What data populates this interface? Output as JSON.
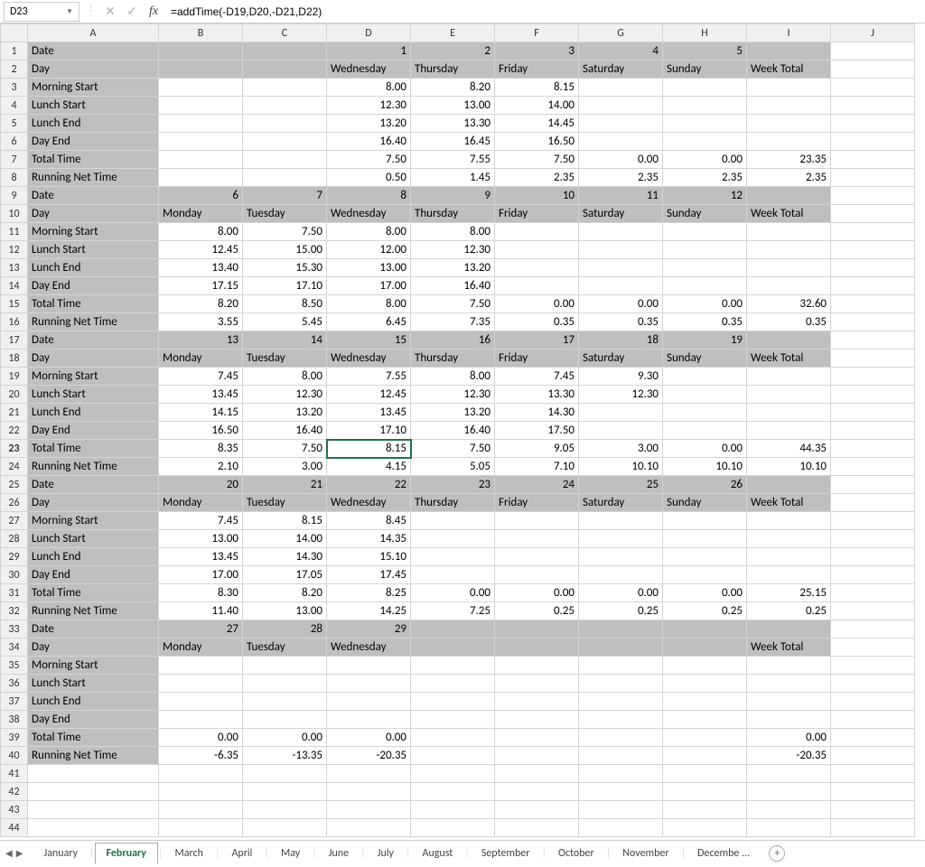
{
  "nameBox": "D23",
  "formula": "=addTime(-D19,D20,-D21,D22)",
  "activeCell": {
    "row": 23,
    "col": 4
  },
  "boldRowHeader": 23,
  "columns": [
    "A",
    "B",
    "C",
    "D",
    "E",
    "F",
    "G",
    "H",
    "I",
    "J"
  ],
  "rowCount": 44,
  "shadedRows": [
    1,
    2,
    9,
    10,
    17,
    18,
    25,
    26,
    33,
    34
  ],
  "colAShadedAll": true,
  "cells": {
    "1": {
      "A": {
        "v": "Date",
        "a": "txt"
      },
      "D": {
        "v": "1",
        "a": "num"
      },
      "E": {
        "v": "2",
        "a": "num"
      },
      "F": {
        "v": "3",
        "a": "num"
      },
      "G": {
        "v": "4",
        "a": "num"
      },
      "H": {
        "v": "5",
        "a": "num"
      }
    },
    "2": {
      "A": {
        "v": "Day",
        "a": "txt"
      },
      "D": {
        "v": "Wednesday",
        "a": "txt"
      },
      "E": {
        "v": "Thursday",
        "a": "txt"
      },
      "F": {
        "v": "Friday",
        "a": "txt"
      },
      "G": {
        "v": "Saturday",
        "a": "txt"
      },
      "H": {
        "v": "Sunday",
        "a": "txt"
      },
      "I": {
        "v": "Week Total",
        "a": "txt"
      }
    },
    "3": {
      "A": {
        "v": "Morning Start",
        "a": "txt"
      },
      "D": {
        "v": "8.00",
        "a": "num"
      },
      "E": {
        "v": "8.20",
        "a": "num"
      },
      "F": {
        "v": "8.15",
        "a": "num"
      }
    },
    "4": {
      "A": {
        "v": "Lunch Start",
        "a": "txt"
      },
      "D": {
        "v": "12.30",
        "a": "num"
      },
      "E": {
        "v": "13.00",
        "a": "num"
      },
      "F": {
        "v": "14.00",
        "a": "num"
      }
    },
    "5": {
      "A": {
        "v": "Lunch End",
        "a": "txt"
      },
      "D": {
        "v": "13.20",
        "a": "num"
      },
      "E": {
        "v": "13.30",
        "a": "num"
      },
      "F": {
        "v": "14.45",
        "a": "num"
      }
    },
    "6": {
      "A": {
        "v": "Day End",
        "a": "txt"
      },
      "D": {
        "v": "16.40",
        "a": "num"
      },
      "E": {
        "v": "16.45",
        "a": "num"
      },
      "F": {
        "v": "16.50",
        "a": "num"
      }
    },
    "7": {
      "A": {
        "v": "Total Time",
        "a": "txt"
      },
      "D": {
        "v": "7.50",
        "a": "num"
      },
      "E": {
        "v": "7.55",
        "a": "num"
      },
      "F": {
        "v": "7.50",
        "a": "num"
      },
      "G": {
        "v": "0.00",
        "a": "num"
      },
      "H": {
        "v": "0.00",
        "a": "num"
      },
      "I": {
        "v": "23.35",
        "a": "num"
      }
    },
    "8": {
      "A": {
        "v": "Running Net Time",
        "a": "txt"
      },
      "D": {
        "v": "0.50",
        "a": "num"
      },
      "E": {
        "v": "1.45",
        "a": "num"
      },
      "F": {
        "v": "2.35",
        "a": "num"
      },
      "G": {
        "v": "2.35",
        "a": "num"
      },
      "H": {
        "v": "2.35",
        "a": "num"
      },
      "I": {
        "v": "2.35",
        "a": "num"
      }
    },
    "9": {
      "A": {
        "v": "Date",
        "a": "txt"
      },
      "B": {
        "v": "6",
        "a": "num"
      },
      "C": {
        "v": "7",
        "a": "num"
      },
      "D": {
        "v": "8",
        "a": "num"
      },
      "E": {
        "v": "9",
        "a": "num"
      },
      "F": {
        "v": "10",
        "a": "num"
      },
      "G": {
        "v": "11",
        "a": "num"
      },
      "H": {
        "v": "12",
        "a": "num"
      }
    },
    "10": {
      "A": {
        "v": "Day",
        "a": "txt"
      },
      "B": {
        "v": "Monday",
        "a": "txt"
      },
      "C": {
        "v": "Tuesday",
        "a": "txt"
      },
      "D": {
        "v": "Wednesday",
        "a": "txt"
      },
      "E": {
        "v": "Thursday",
        "a": "txt"
      },
      "F": {
        "v": "Friday",
        "a": "txt"
      },
      "G": {
        "v": "Saturday",
        "a": "txt"
      },
      "H": {
        "v": "Sunday",
        "a": "txt"
      },
      "I": {
        "v": "Week Total",
        "a": "txt"
      }
    },
    "11": {
      "A": {
        "v": "Morning Start",
        "a": "txt"
      },
      "B": {
        "v": "8.00",
        "a": "num"
      },
      "C": {
        "v": "7.50",
        "a": "num"
      },
      "D": {
        "v": "8.00",
        "a": "num"
      },
      "E": {
        "v": "8.00",
        "a": "num"
      }
    },
    "12": {
      "A": {
        "v": "Lunch Start",
        "a": "txt"
      },
      "B": {
        "v": "12.45",
        "a": "num"
      },
      "C": {
        "v": "15.00",
        "a": "num"
      },
      "D": {
        "v": "12.00",
        "a": "num"
      },
      "E": {
        "v": "12.30",
        "a": "num"
      }
    },
    "13": {
      "A": {
        "v": "Lunch End",
        "a": "txt"
      },
      "B": {
        "v": "13.40",
        "a": "num"
      },
      "C": {
        "v": "15.30",
        "a": "num"
      },
      "D": {
        "v": "13.00",
        "a": "num"
      },
      "E": {
        "v": "13.20",
        "a": "num"
      }
    },
    "14": {
      "A": {
        "v": "Day End",
        "a": "txt"
      },
      "B": {
        "v": "17.15",
        "a": "num"
      },
      "C": {
        "v": "17.10",
        "a": "num"
      },
      "D": {
        "v": "17.00",
        "a": "num"
      },
      "E": {
        "v": "16.40",
        "a": "num"
      }
    },
    "15": {
      "A": {
        "v": "Total Time",
        "a": "txt"
      },
      "B": {
        "v": "8.20",
        "a": "num"
      },
      "C": {
        "v": "8.50",
        "a": "num"
      },
      "D": {
        "v": "8.00",
        "a": "num"
      },
      "E": {
        "v": "7.50",
        "a": "num"
      },
      "F": {
        "v": "0.00",
        "a": "num"
      },
      "G": {
        "v": "0.00",
        "a": "num"
      },
      "H": {
        "v": "0.00",
        "a": "num"
      },
      "I": {
        "v": "32.60",
        "a": "num"
      }
    },
    "16": {
      "A": {
        "v": "Running Net Time",
        "a": "txt"
      },
      "B": {
        "v": "3.55",
        "a": "num"
      },
      "C": {
        "v": "5.45",
        "a": "num"
      },
      "D": {
        "v": "6.45",
        "a": "num"
      },
      "E": {
        "v": "7.35",
        "a": "num"
      },
      "F": {
        "v": "0.35",
        "a": "num"
      },
      "G": {
        "v": "0.35",
        "a": "num"
      },
      "H": {
        "v": "0.35",
        "a": "num"
      },
      "I": {
        "v": "0.35",
        "a": "num"
      }
    },
    "17": {
      "A": {
        "v": "Date",
        "a": "txt"
      },
      "B": {
        "v": "13",
        "a": "num"
      },
      "C": {
        "v": "14",
        "a": "num"
      },
      "D": {
        "v": "15",
        "a": "num"
      },
      "E": {
        "v": "16",
        "a": "num"
      },
      "F": {
        "v": "17",
        "a": "num"
      },
      "G": {
        "v": "18",
        "a": "num"
      },
      "H": {
        "v": "19",
        "a": "num"
      }
    },
    "18": {
      "A": {
        "v": "Day",
        "a": "txt"
      },
      "B": {
        "v": "Monday",
        "a": "txt"
      },
      "C": {
        "v": "Tuesday",
        "a": "txt"
      },
      "D": {
        "v": "Wednesday",
        "a": "txt"
      },
      "E": {
        "v": "Thursday",
        "a": "txt"
      },
      "F": {
        "v": "Friday",
        "a": "txt"
      },
      "G": {
        "v": "Saturday",
        "a": "txt"
      },
      "H": {
        "v": "Sunday",
        "a": "txt"
      },
      "I": {
        "v": "Week Total",
        "a": "txt"
      }
    },
    "19": {
      "A": {
        "v": "Morning Start",
        "a": "txt"
      },
      "B": {
        "v": "7.45",
        "a": "num"
      },
      "C": {
        "v": "8.00",
        "a": "num"
      },
      "D": {
        "v": "7.55",
        "a": "num"
      },
      "E": {
        "v": "8.00",
        "a": "num"
      },
      "F": {
        "v": "7.45",
        "a": "num"
      },
      "G": {
        "v": "9.30",
        "a": "num"
      }
    },
    "20": {
      "A": {
        "v": "Lunch Start",
        "a": "txt"
      },
      "B": {
        "v": "13.45",
        "a": "num"
      },
      "C": {
        "v": "12.30",
        "a": "num"
      },
      "D": {
        "v": "12.45",
        "a": "num"
      },
      "E": {
        "v": "12.30",
        "a": "num"
      },
      "F": {
        "v": "13.30",
        "a": "num"
      },
      "G": {
        "v": "12.30",
        "a": "num"
      }
    },
    "21": {
      "A": {
        "v": "Lunch End",
        "a": "txt"
      },
      "B": {
        "v": "14.15",
        "a": "num"
      },
      "C": {
        "v": "13.20",
        "a": "num"
      },
      "D": {
        "v": "13.45",
        "a": "num"
      },
      "E": {
        "v": "13.20",
        "a": "num"
      },
      "F": {
        "v": "14.30",
        "a": "num"
      }
    },
    "22": {
      "A": {
        "v": "Day End",
        "a": "txt"
      },
      "B": {
        "v": "16.50",
        "a": "num"
      },
      "C": {
        "v": "16.40",
        "a": "num"
      },
      "D": {
        "v": "17.10",
        "a": "num"
      },
      "E": {
        "v": "16.40",
        "a": "num"
      },
      "F": {
        "v": "17.50",
        "a": "num"
      }
    },
    "23": {
      "A": {
        "v": "Total Time",
        "a": "txt"
      },
      "B": {
        "v": "8.35",
        "a": "num"
      },
      "C": {
        "v": "7.50",
        "a": "num"
      },
      "D": {
        "v": "8.15",
        "a": "num"
      },
      "E": {
        "v": "7.50",
        "a": "num"
      },
      "F": {
        "v": "9.05",
        "a": "num"
      },
      "G": {
        "v": "3.00",
        "a": "num"
      },
      "H": {
        "v": "0.00",
        "a": "num"
      },
      "I": {
        "v": "44.35",
        "a": "num"
      }
    },
    "24": {
      "A": {
        "v": "Running Net Time",
        "a": "txt"
      },
      "B": {
        "v": "2.10",
        "a": "num"
      },
      "C": {
        "v": "3.00",
        "a": "num"
      },
      "D": {
        "v": "4.15",
        "a": "num"
      },
      "E": {
        "v": "5.05",
        "a": "num"
      },
      "F": {
        "v": "7.10",
        "a": "num"
      },
      "G": {
        "v": "10.10",
        "a": "num"
      },
      "H": {
        "v": "10.10",
        "a": "num"
      },
      "I": {
        "v": "10.10",
        "a": "num"
      }
    },
    "25": {
      "A": {
        "v": "Date",
        "a": "txt"
      },
      "B": {
        "v": "20",
        "a": "num"
      },
      "C": {
        "v": "21",
        "a": "num"
      },
      "D": {
        "v": "22",
        "a": "num"
      },
      "E": {
        "v": "23",
        "a": "num"
      },
      "F": {
        "v": "24",
        "a": "num"
      },
      "G": {
        "v": "25",
        "a": "num"
      },
      "H": {
        "v": "26",
        "a": "num"
      }
    },
    "26": {
      "A": {
        "v": "Day",
        "a": "txt"
      },
      "B": {
        "v": "Monday",
        "a": "txt"
      },
      "C": {
        "v": "Tuesday",
        "a": "txt"
      },
      "D": {
        "v": "Wednesday",
        "a": "txt"
      },
      "E": {
        "v": "Thursday",
        "a": "txt"
      },
      "F": {
        "v": "Friday",
        "a": "txt"
      },
      "G": {
        "v": "Saturday",
        "a": "txt"
      },
      "H": {
        "v": "Sunday",
        "a": "txt"
      },
      "I": {
        "v": "Week Total",
        "a": "txt"
      }
    },
    "27": {
      "A": {
        "v": "Morning Start",
        "a": "txt"
      },
      "B": {
        "v": "7.45",
        "a": "num"
      },
      "C": {
        "v": "8.15",
        "a": "num"
      },
      "D": {
        "v": "8.45",
        "a": "num"
      }
    },
    "28": {
      "A": {
        "v": "Lunch Start",
        "a": "txt"
      },
      "B": {
        "v": "13.00",
        "a": "num"
      },
      "C": {
        "v": "14.00",
        "a": "num"
      },
      "D": {
        "v": "14.35",
        "a": "num"
      }
    },
    "29": {
      "A": {
        "v": "Lunch End",
        "a": "txt"
      },
      "B": {
        "v": "13.45",
        "a": "num"
      },
      "C": {
        "v": "14.30",
        "a": "num"
      },
      "D": {
        "v": "15.10",
        "a": "num"
      }
    },
    "30": {
      "A": {
        "v": "Day End",
        "a": "txt"
      },
      "B": {
        "v": "17.00",
        "a": "num"
      },
      "C": {
        "v": "17.05",
        "a": "num"
      },
      "D": {
        "v": "17.45",
        "a": "num"
      }
    },
    "31": {
      "A": {
        "v": "Total Time",
        "a": "txt"
      },
      "B": {
        "v": "8.30",
        "a": "num"
      },
      "C": {
        "v": "8.20",
        "a": "num"
      },
      "D": {
        "v": "8.25",
        "a": "num"
      },
      "E": {
        "v": "0.00",
        "a": "num"
      },
      "F": {
        "v": "0.00",
        "a": "num"
      },
      "G": {
        "v": "0.00",
        "a": "num"
      },
      "H": {
        "v": "0.00",
        "a": "num"
      },
      "I": {
        "v": "25.15",
        "a": "num"
      }
    },
    "32": {
      "A": {
        "v": "Running Net Time",
        "a": "txt"
      },
      "B": {
        "v": "11.40",
        "a": "num"
      },
      "C": {
        "v": "13.00",
        "a": "num"
      },
      "D": {
        "v": "14.25",
        "a": "num"
      },
      "E": {
        "v": "7.25",
        "a": "num"
      },
      "F": {
        "v": "0.25",
        "a": "num"
      },
      "G": {
        "v": "0.25",
        "a": "num"
      },
      "H": {
        "v": "0.25",
        "a": "num"
      },
      "I": {
        "v": "0.25",
        "a": "num"
      }
    },
    "33": {
      "A": {
        "v": "Date",
        "a": "txt"
      },
      "B": {
        "v": "27",
        "a": "num"
      },
      "C": {
        "v": "28",
        "a": "num"
      },
      "D": {
        "v": "29",
        "a": "num"
      }
    },
    "34": {
      "A": {
        "v": "Day",
        "a": "txt"
      },
      "B": {
        "v": "Monday",
        "a": "txt"
      },
      "C": {
        "v": "Tuesday",
        "a": "txt"
      },
      "D": {
        "v": "Wednesday",
        "a": "txt"
      },
      "I": {
        "v": "Week Total",
        "a": "txt"
      }
    },
    "35": {
      "A": {
        "v": "Morning Start",
        "a": "txt"
      }
    },
    "36": {
      "A": {
        "v": "Lunch Start",
        "a": "txt"
      }
    },
    "37": {
      "A": {
        "v": "Lunch End",
        "a": "txt"
      }
    },
    "38": {
      "A": {
        "v": "Day End",
        "a": "txt"
      }
    },
    "39": {
      "A": {
        "v": "Total Time",
        "a": "txt"
      },
      "B": {
        "v": "0.00",
        "a": "num"
      },
      "C": {
        "v": "0.00",
        "a": "num"
      },
      "D": {
        "v": "0.00",
        "a": "num"
      },
      "I": {
        "v": "0.00",
        "a": "num"
      }
    },
    "40": {
      "A": {
        "v": "Running Net Time",
        "a": "txt"
      },
      "B": {
        "v": "-6.35",
        "a": "num"
      },
      "C": {
        "v": "-13.35",
        "a": "num"
      },
      "D": {
        "v": "-20.35",
        "a": "num"
      },
      "I": {
        "v": "-20.35",
        "a": "num"
      }
    }
  },
  "sheetTabs": [
    "January",
    "February",
    "March",
    "April",
    "May",
    "June",
    "July",
    "August",
    "September",
    "October",
    "November",
    "Decembe ..."
  ],
  "activeSheet": "February"
}
